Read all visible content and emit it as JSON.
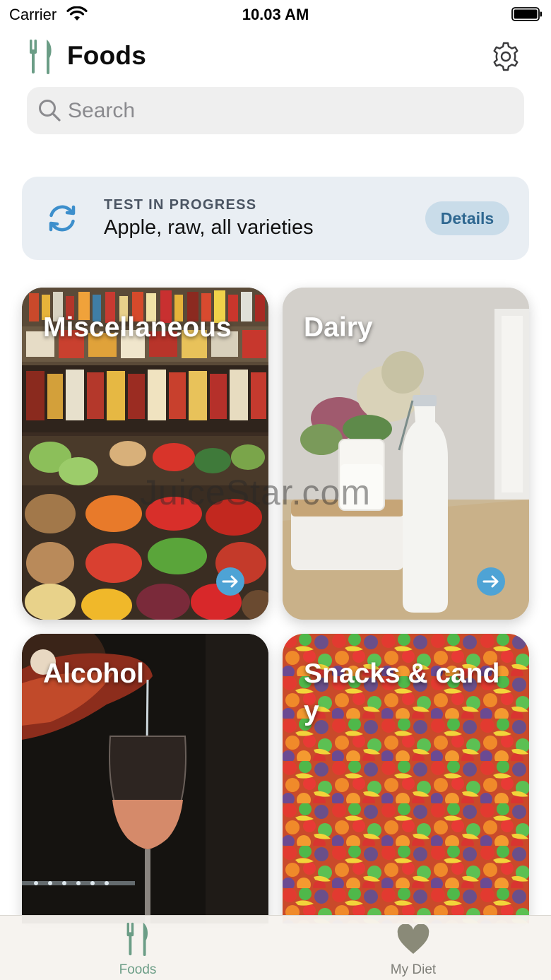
{
  "status_bar": {
    "carrier": "Carrier",
    "time": "10.03 AM"
  },
  "header": {
    "title": "Foods",
    "logo_icon": "fork-knife-icon",
    "settings_icon": "gear-icon"
  },
  "search": {
    "placeholder": "Search",
    "value": ""
  },
  "test_card": {
    "status_label": "TEST IN PROGRESS",
    "food_name": "Apple, raw, all varieties",
    "details_label": "Details",
    "icon": "sync-icon"
  },
  "categories": [
    {
      "label": "Miscellaneous",
      "image": "market-stall-photo"
    },
    {
      "label": "Dairy",
      "image": "milk-bottle-photo"
    },
    {
      "label": "Alcohol",
      "image": "wine-glass-photo"
    },
    {
      "label": "Snacks & candy",
      "image": "candy-photo"
    }
  ],
  "watermark": "JuiceStar.com",
  "tab_bar": {
    "tabs": [
      {
        "label": "Foods",
        "icon": "fork-knife-icon",
        "active": true
      },
      {
        "label": "My Diet",
        "icon": "heart-icon",
        "active": false
      }
    ]
  },
  "colors": {
    "accent": "#6b9d86",
    "arrow_button": "#4ea3d5",
    "details_bg": "#c9dce9",
    "details_text": "#2e6790",
    "test_card_bg": "#e9eef3"
  }
}
